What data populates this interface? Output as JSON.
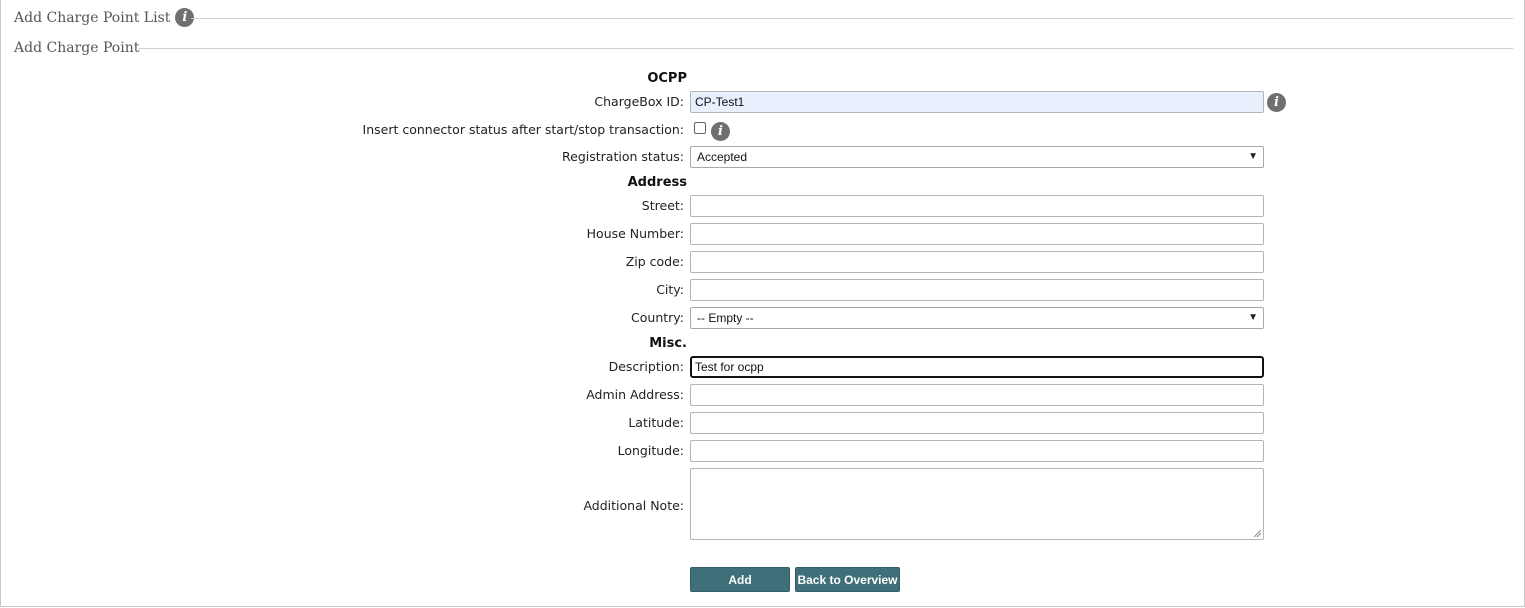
{
  "sections": {
    "list_title": "Add Charge Point List",
    "single_title": "Add Charge Point"
  },
  "groups": {
    "ocpp": "OCPP",
    "address": "Address",
    "misc": "Misc."
  },
  "fields": {
    "chargebox_id": {
      "label": "ChargeBox ID:",
      "value": "CP-Test1"
    },
    "insert_connector": {
      "label": "Insert connector status after start/stop transaction:",
      "checked": false
    },
    "registration_status": {
      "label": "Registration status:",
      "value": "Accepted"
    },
    "street": {
      "label": "Street:",
      "value": ""
    },
    "house_number": {
      "label": "House Number:",
      "value": ""
    },
    "zip_code": {
      "label": "Zip code:",
      "value": ""
    },
    "city": {
      "label": "City:",
      "value": ""
    },
    "country": {
      "label": "Country:",
      "value": "-- Empty --"
    },
    "description": {
      "label": "Description:",
      "value": "Test for ocpp"
    },
    "admin_address": {
      "label": "Admin Address:",
      "value": ""
    },
    "latitude": {
      "label": "Latitude:",
      "value": ""
    },
    "longitude": {
      "label": "Longitude:",
      "value": ""
    },
    "additional_note": {
      "label": "Additional Note:",
      "value": ""
    }
  },
  "buttons": {
    "add": "Add",
    "back": "Back to Overview"
  },
  "icons": {
    "info": "info-icon",
    "dropdown": "chevron-down-icon"
  },
  "colors": {
    "button_bg": "#3f6f78",
    "autofill_bg": "#e8f0fe"
  }
}
